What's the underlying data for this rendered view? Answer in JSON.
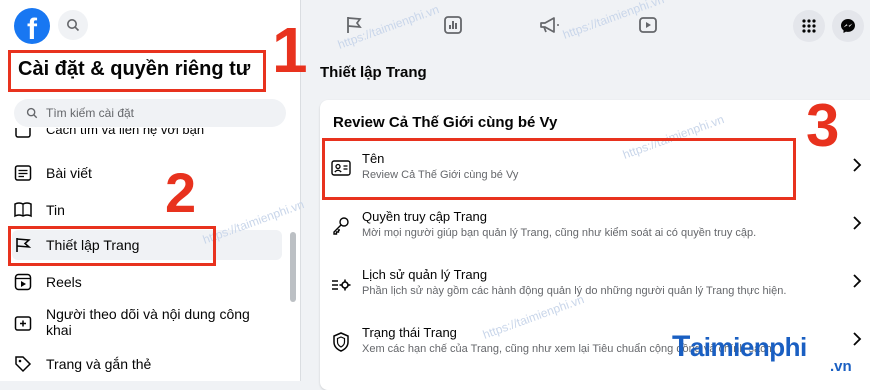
{
  "sidebar": {
    "title": "Cài đặt & quyền riêng tư",
    "search_placeholder": "Tìm kiếm cài đặt",
    "partial_item": "Cách tìm và liên hệ với bạn",
    "items": [
      {
        "label": "Bài viết",
        "icon": "post-icon"
      },
      {
        "label": "Tin",
        "icon": "book-icon"
      },
      {
        "label": "Thiết lập Trang",
        "icon": "flag-icon"
      },
      {
        "label": "Reels",
        "icon": "reels-icon"
      },
      {
        "label": "Người theo dõi và nội dung công khai",
        "icon": "public-icon"
      },
      {
        "label": "Trang và gắn thẻ",
        "icon": "tag-icon"
      }
    ]
  },
  "main": {
    "title": "Thiết lập Trang",
    "card_title": "Review Cả Thế Giới cùng bé Vy",
    "rows": [
      {
        "label": "Tên",
        "desc": "Review Cả Thế Giới cùng bé Vy",
        "icon": "id-card-icon"
      },
      {
        "label": "Quyền truy cập Trang",
        "desc": "Mời mọi người giúp bạn quản lý Trang, cũng như kiểm soát ai có quyền truy cập.",
        "icon": "key-icon"
      },
      {
        "label": "Lịch sử quản lý Trang",
        "desc": "Phần lịch sử này gồm các hành động quản lý do những người quản lý Trang thực hiện.",
        "icon": "settings-list-icon"
      },
      {
        "label": "Trạng thái Trang",
        "desc": "Xem các hạn chế của Trang, cũng như xem lại Tiêu chuẩn cộng đồng và chính sách",
        "icon": "shield-icon"
      }
    ]
  },
  "annotations": {
    "n1": "1",
    "n2": "2",
    "n3": "3"
  },
  "watermark": {
    "text": "https://taimienphi.vn",
    "brand": "aimienphi",
    "brand_initial": "T",
    "brand_tld": ".vn"
  },
  "colors": {
    "accent": "#1877f2",
    "annotation": "#e8321e",
    "background": "#f0f2f5"
  }
}
